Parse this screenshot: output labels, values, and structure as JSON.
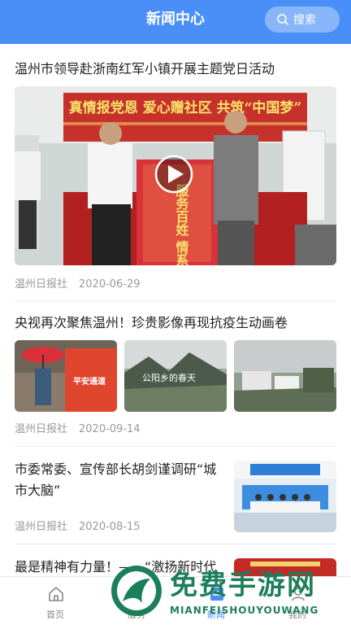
{
  "header": {
    "title": "新闻中心",
    "search_label": "搜索"
  },
  "articles": [
    {
      "title": "温州市领导赴浙南红军小镇开展主题党日活动",
      "source": "温州日报社",
      "date": "2020-06-29",
      "banner_text": "真情报党恩 爱心赠社区 共筑“中国梦”",
      "flag_text": "服务百姓  情系社区"
    },
    {
      "title": "央视再次聚焦温州！珍贵影像再现抗疫生动画卷",
      "source": "温州日报社",
      "date": "2020-09-14",
      "img_caption": "公阳乡的春天",
      "vest_text": "平安通道"
    },
    {
      "title_line1": "市委常委、宣传部长胡剑谨调研“城",
      "title_line2": "市大脑”",
      "source": "温州日报社",
      "date": "2020-08-15"
    },
    {
      "title": "最是精神有力量！——“激扬新时代"
    }
  ],
  "tabbar": {
    "items": [
      {
        "label": "首页"
      },
      {
        "label": "服务"
      },
      {
        "label": "新闻"
      },
      {
        "label": "我的"
      }
    ]
  },
  "watermark": {
    "text": "免费手游网",
    "sub": "MIANFEISHOUYOUWANG"
  },
  "colors": {
    "primary": "#4a8ff7",
    "watermark": "#1b7f5a"
  }
}
